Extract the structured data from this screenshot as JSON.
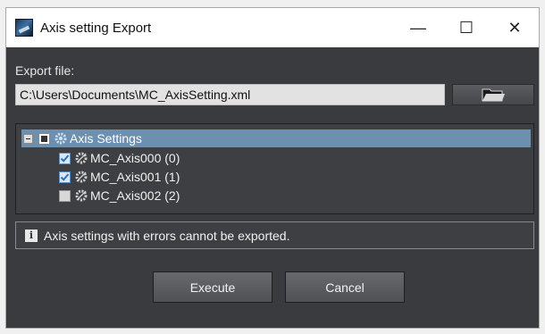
{
  "window": {
    "title": "Axis setting Export",
    "controls": {
      "minimize": "—",
      "maximize": "☐",
      "close": "✕"
    }
  },
  "export": {
    "label": "Export file:",
    "path_value": "C:\\Users\\Documents\\MC_AxisSetting.xml",
    "browse_icon": "folder-icon"
  },
  "tree": {
    "root": {
      "label": "Axis Settings",
      "state": "partial",
      "icon": "gear-icon"
    },
    "items": [
      {
        "label": "MC_Axis000 (0)",
        "checked": true,
        "icon": "gear-icon"
      },
      {
        "label": "MC_Axis001 (1)",
        "checked": true,
        "icon": "gear-icon"
      },
      {
        "label": "MC_Axis002 (2)",
        "checked": false,
        "icon": "gear-icon"
      }
    ]
  },
  "info": {
    "icon": "info-icon",
    "icon_glyph": "i",
    "text": "Axis settings with errors cannot be exported."
  },
  "buttons": {
    "execute": "Execute",
    "cancel": "Cancel"
  },
  "colors": {
    "dialog_bg": "#3a3b3e",
    "selection": "#6d8fb0",
    "check": "#2f73c0"
  }
}
